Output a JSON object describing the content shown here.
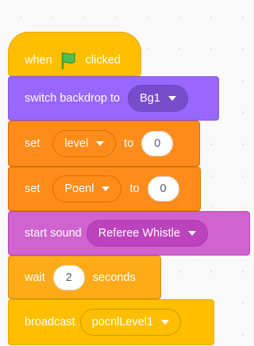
{
  "blocks": {
    "event_hat": {
      "prefix": "when",
      "icon": "green-flag-icon",
      "suffix": "clicked"
    },
    "switch_backdrop": {
      "label": "switch backdrop to",
      "value": "Bg1"
    },
    "set_level": {
      "label": "set",
      "variable": "level",
      "to_label": "to",
      "value": "0"
    },
    "set_poenl": {
      "label": "set",
      "variable": "Poenl",
      "to_label": "to",
      "value": "0"
    },
    "start_sound": {
      "label": "start sound",
      "value": "Referee Whistle"
    },
    "wait": {
      "label": "wait",
      "value": "2",
      "unit": "seconds"
    },
    "broadcast": {
      "label": "broadcast",
      "value": "pocnlLevel1"
    }
  },
  "colors": {
    "events": "#ffbf00",
    "looks": "#9966ff",
    "variables": "#ff8c1a",
    "sound": "#cf63cf",
    "control": "#ffab19",
    "flag": "#4cbf56"
  }
}
